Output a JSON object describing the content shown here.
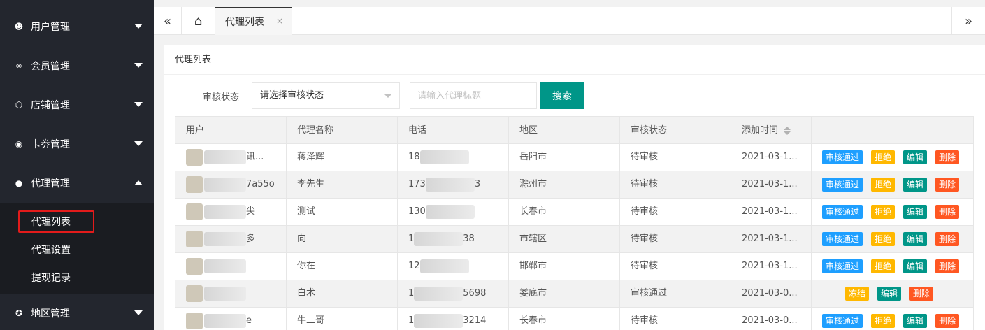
{
  "sidebar": {
    "items": [
      {
        "label": "用户管理",
        "icon": "user-outline-icon"
      },
      {
        "label": "会员管理",
        "icon": "infinity-icon"
      },
      {
        "label": "店铺管理",
        "icon": "box-icon"
      },
      {
        "label": "卡劵管理",
        "icon": "circle-icon"
      },
      {
        "label": "代理管理",
        "icon": "user-solid-icon"
      },
      {
        "label": "地区管理",
        "icon": "compass-icon"
      }
    ],
    "sub_items": [
      "代理列表",
      "代理设置",
      "提现记录"
    ]
  },
  "tabs": {
    "active": "代理列表",
    "close": "×"
  },
  "card": {
    "title": "代理列表"
  },
  "filter": {
    "status_label": "审核状态",
    "status_value": "请选择审核状态",
    "keyword_placeholder": "请输入代理标题",
    "search_label": "搜索"
  },
  "table": {
    "columns": [
      "用户",
      "代理名称",
      "电话",
      "地区",
      "审核状态",
      "添加时间"
    ],
    "rows": [
      {
        "user": "讯...",
        "name": "蒋泽辉",
        "phone_prefix": "18",
        "phone_suffix": "",
        "region": "岳阳市",
        "status": "待审核",
        "time": "2021-03-1...",
        "ops": [
          "审核通过",
          "拒绝",
          "编辑",
          "删除"
        ]
      },
      {
        "user": "7a55o",
        "name": "李先生",
        "phone_prefix": "173",
        "phone_suffix": "3",
        "region": "滁州市",
        "status": "待审核",
        "time": "2021-03-1...",
        "ops": [
          "审核通过",
          "拒绝",
          "编辑",
          "删除"
        ]
      },
      {
        "user": "尖",
        "name": "测试",
        "phone_prefix": "130",
        "phone_suffix": "",
        "region": "长春市",
        "status": "待审核",
        "time": "2021-03-1...",
        "ops": [
          "审核通过",
          "拒绝",
          "编辑",
          "删除"
        ]
      },
      {
        "user": "多",
        "name": "向",
        "phone_prefix": "1",
        "phone_suffix": "38",
        "region": "市辖区",
        "status": "待审核",
        "time": "2021-03-1...",
        "ops": [
          "审核通过",
          "拒绝",
          "编辑",
          "删除"
        ]
      },
      {
        "user": "",
        "name": "你在",
        "phone_prefix": "12",
        "phone_suffix": "",
        "region": "邯郸市",
        "status": "待审核",
        "time": "2021-03-1...",
        "ops": [
          "审核通过",
          "拒绝",
          "编辑",
          "删除"
        ]
      },
      {
        "user": "",
        "name": "白术",
        "phone_prefix": "1",
        "phone_suffix": "5698",
        "region": "娄底市",
        "status": "审核通过",
        "time": "2021-03-0...",
        "ops": [
          "冻结",
          "编辑",
          "删除"
        ]
      },
      {
        "user": "e",
        "name": "牛二哥",
        "phone_prefix": "1",
        "phone_suffix": "3214",
        "region": "长春市",
        "status": "待审核",
        "time": "2021-03-0...",
        "ops": [
          "审核通过",
          "拒绝",
          "编辑",
          "删除"
        ]
      }
    ]
  },
  "colors": {
    "sidebar_bg": "#23262e",
    "primary": "#009688",
    "blue": "#1e9fff",
    "yellow": "#ffb800",
    "red": "#ff5722"
  }
}
